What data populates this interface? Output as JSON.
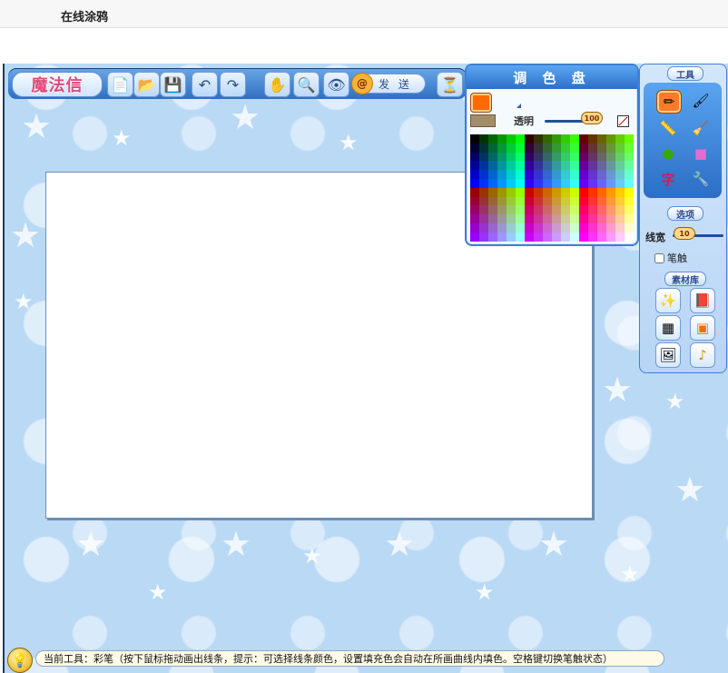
{
  "page": {
    "title": "在线涂鸦"
  },
  "toolbar": {
    "logo_text": "魔法信",
    "buttons": [
      {
        "name": "new-file",
        "icon": "📄"
      },
      {
        "name": "open-folder",
        "icon": "📂"
      },
      {
        "name": "save",
        "icon": "💾"
      },
      {
        "name": "undo",
        "icon": "↶"
      },
      {
        "name": "redo",
        "icon": "↷"
      },
      {
        "name": "pan-hand",
        "icon": "✋"
      },
      {
        "name": "zoom",
        "icon": "🔍"
      },
      {
        "name": "preview",
        "icon": "👁"
      }
    ],
    "send_label": "发 送",
    "send_icon": "@",
    "hourglass_icon": "⏳"
  },
  "palette": {
    "title": "调 色 盘",
    "transparency_label": "透明",
    "transparency_value": "100",
    "current_color": "#ff6a00",
    "fill_swatch": "#a38e6c"
  },
  "sidebar": {
    "tools_title": "工具",
    "tools": [
      {
        "name": "brush-tool",
        "icon": "✏",
        "active": true
      },
      {
        "name": "airbrush-tool",
        "icon": "🖌",
        "active": false
      },
      {
        "name": "pencil-tool",
        "icon": "📏",
        "active": false
      },
      {
        "name": "eraser-tool",
        "icon": "🧹",
        "active": false
      },
      {
        "name": "ellipse-tool",
        "icon": "●",
        "active": false
      },
      {
        "name": "rect-tool",
        "icon": "■",
        "active": false
      },
      {
        "name": "text-tool",
        "icon": "字",
        "active": false
      },
      {
        "name": "settings-tool",
        "icon": "🔧",
        "active": false
      }
    ],
    "options_title": "选项",
    "line_width_label": "线宽",
    "line_width_value": "10",
    "brush_touch_label": "笔触",
    "materials_title": "素材库",
    "materials": [
      {
        "name": "magic-wand",
        "icon": "✨"
      },
      {
        "name": "stamp-book",
        "icon": "📕"
      },
      {
        "name": "pattern",
        "icon": "▦"
      },
      {
        "name": "frame",
        "icon": "▣"
      },
      {
        "name": "background",
        "icon": "🖼"
      },
      {
        "name": "music",
        "icon": "♪"
      }
    ]
  },
  "status": {
    "icon": "💡",
    "text": "当前工具：彩笔（按下鼠标拖动画出线条，提示：可选择线条颜色，设置填充色会自动在所画曲线内填色。空格键切换笔触状态）"
  },
  "colors": {
    "accent_blue": "#2c6fc9",
    "background_blue": "#b9d9f5",
    "active_tool": "#ff7a2a"
  }
}
